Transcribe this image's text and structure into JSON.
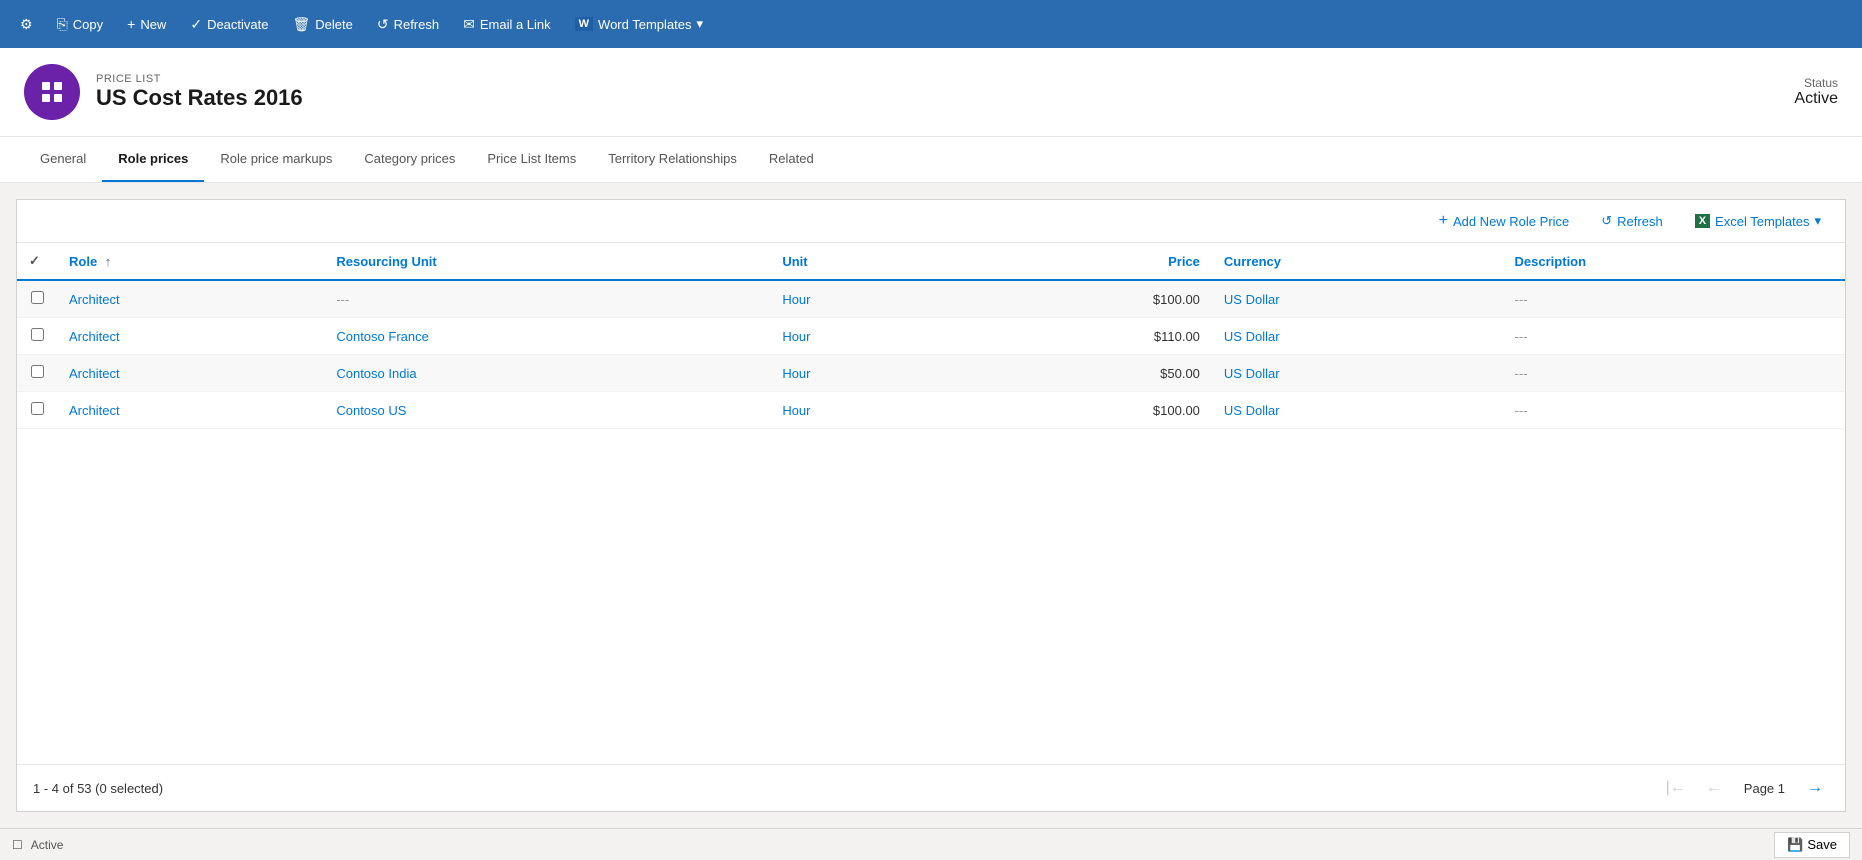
{
  "toolbar": {
    "buttons": [
      {
        "id": "settings",
        "label": "",
        "icon": "⚙"
      },
      {
        "id": "copy",
        "label": "Copy",
        "icon": ""
      },
      {
        "id": "new",
        "label": "New",
        "icon": "+"
      },
      {
        "id": "deactivate",
        "label": "Deactivate",
        "icon": ""
      },
      {
        "id": "delete",
        "label": "Delete",
        "icon": ""
      },
      {
        "id": "refresh",
        "label": "Refresh",
        "icon": "↺"
      },
      {
        "id": "email",
        "label": "Email a Link",
        "icon": "✉"
      },
      {
        "id": "word",
        "label": "Word Templates",
        "icon": "W",
        "hasDropdown": true
      }
    ]
  },
  "header": {
    "record_type": "PRICE LIST",
    "title": "US Cost Rates 2016",
    "avatar_icon": "☰",
    "status_label": "Status",
    "status_value": "Active"
  },
  "tabs": [
    {
      "id": "general",
      "label": "General",
      "active": false
    },
    {
      "id": "role-prices",
      "label": "Role prices",
      "active": true
    },
    {
      "id": "role-price-markups",
      "label": "Role price markups",
      "active": false
    },
    {
      "id": "category-prices",
      "label": "Category prices",
      "active": false
    },
    {
      "id": "price-list-items",
      "label": "Price List Items",
      "active": false
    },
    {
      "id": "territory-relationships",
      "label": "Territory Relationships",
      "active": false
    },
    {
      "id": "related",
      "label": "Related",
      "active": false
    }
  ],
  "table": {
    "add_new_label": "Add New Role Price",
    "refresh_label": "Refresh",
    "excel_templates_label": "Excel Templates",
    "columns": [
      {
        "id": "role",
        "label": "Role"
      },
      {
        "id": "resourcing-unit",
        "label": "Resourcing Unit"
      },
      {
        "id": "unit",
        "label": "Unit"
      },
      {
        "id": "price",
        "label": "Price"
      },
      {
        "id": "currency",
        "label": "Currency"
      },
      {
        "id": "description",
        "label": "Description"
      }
    ],
    "rows": [
      {
        "role": "Architect",
        "resourcing_unit": "---",
        "unit": "Hour",
        "price": "$100.00",
        "currency": "US Dollar",
        "description": "---",
        "alt": true
      },
      {
        "role": "Architect",
        "resourcing_unit": "Contoso France",
        "unit": "Hour",
        "price": "$110.00",
        "currency": "US Dollar",
        "description": "---",
        "alt": false
      },
      {
        "role": "Architect",
        "resourcing_unit": "Contoso India",
        "unit": "Hour",
        "price": "$50.00",
        "currency": "US Dollar",
        "description": "---",
        "alt": true
      },
      {
        "role": "Architect",
        "resourcing_unit": "Contoso US",
        "unit": "Hour",
        "price": "$100.00",
        "currency": "US Dollar",
        "description": "---",
        "alt": false
      }
    ],
    "pagination": {
      "summary": "1 - 4 of 53 (0 selected)",
      "page_label": "Page 1"
    }
  },
  "status_bar": {
    "status": "Active",
    "save_label": "Save",
    "save_icon": "💾"
  }
}
